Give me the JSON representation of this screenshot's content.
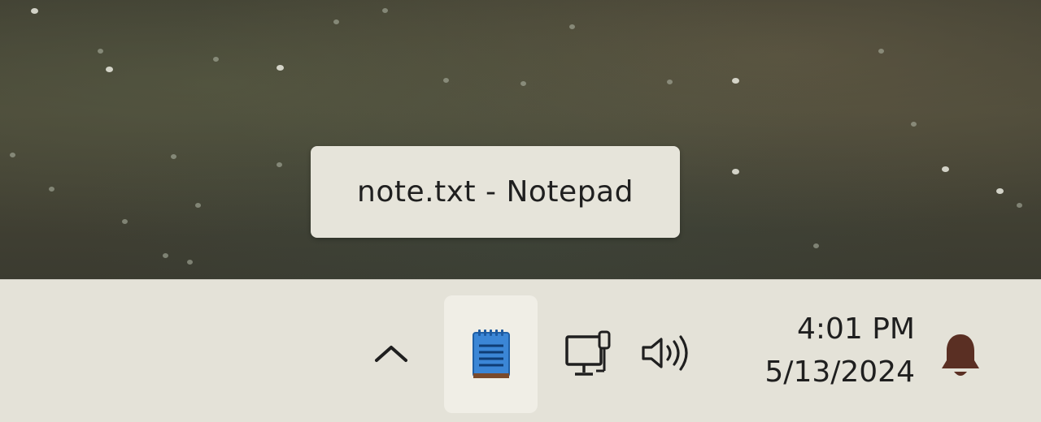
{
  "tooltip": {
    "text": "note.txt - Notepad"
  },
  "taskbar": {
    "show_hidden_icons": {
      "icon": "chevron-up-icon"
    },
    "pinned_app": {
      "icon": "notepad-icon",
      "accent": "#2f78c8"
    },
    "tray": {
      "network_icon": "network-ethernet-icon",
      "volume_icon": "speaker-volume-icon"
    },
    "clock": {
      "time": "4:01 PM",
      "date": "5/13/2024"
    },
    "notifications": {
      "icon": "bell-icon",
      "color": "#5a2f23"
    }
  },
  "colors": {
    "taskbar_bg": "#e4e2d8",
    "tooltip_bg": "#e6e4da",
    "active_button_bg": "#f0eee6"
  }
}
